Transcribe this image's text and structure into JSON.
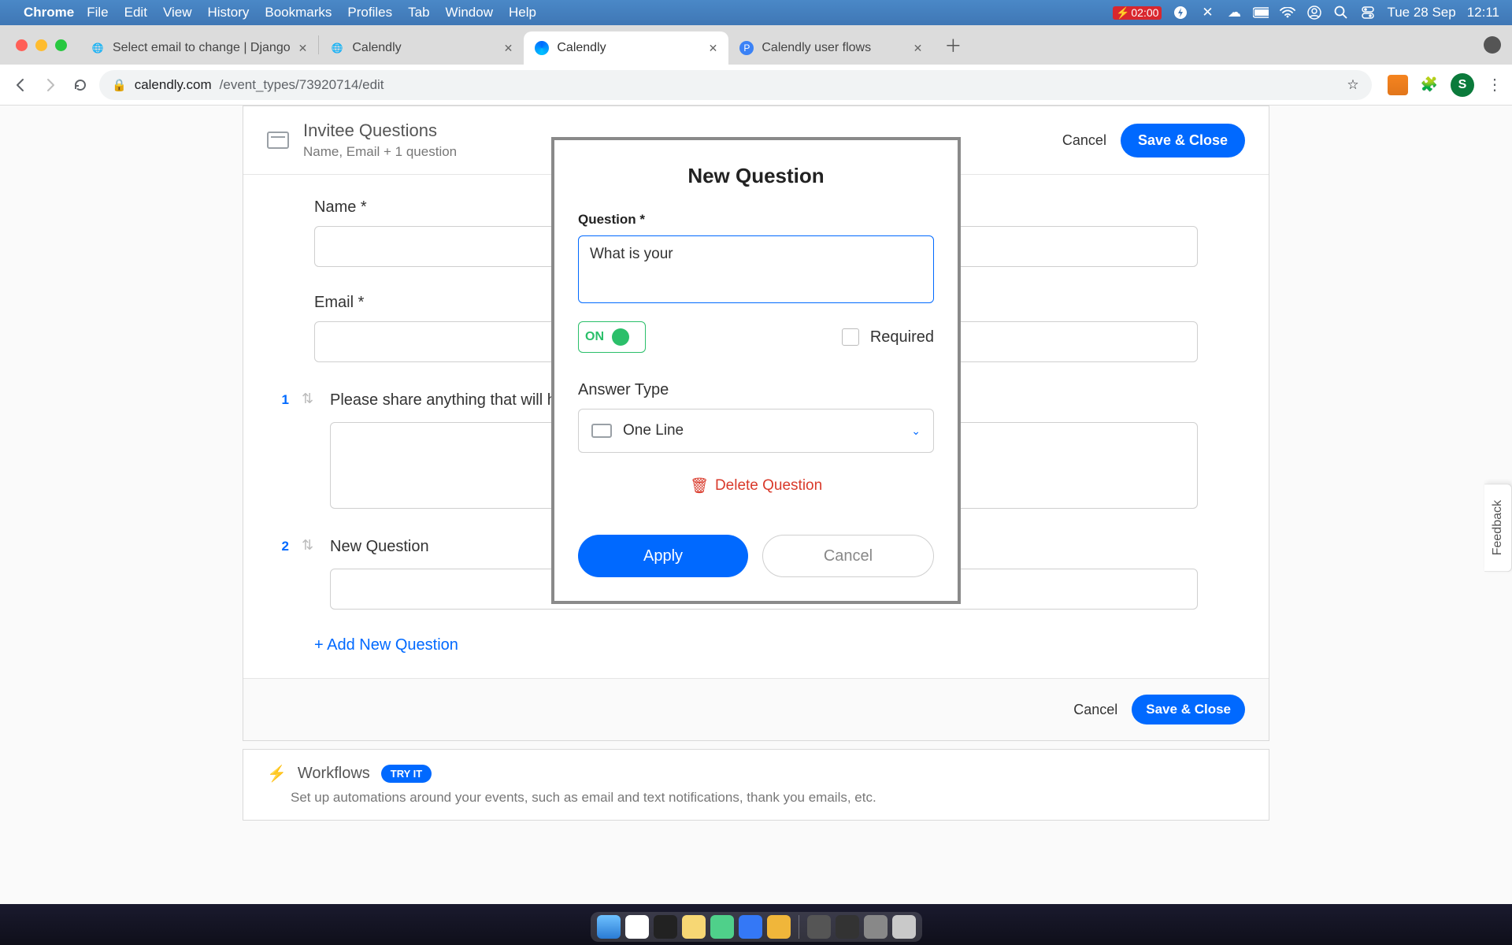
{
  "menubar": {
    "app": "Chrome",
    "items": [
      "File",
      "Edit",
      "View",
      "History",
      "Bookmarks",
      "Profiles",
      "Tab",
      "Window",
      "Help"
    ],
    "battery_time": "02:00",
    "date": "Tue 28 Sep",
    "clock": "12:11"
  },
  "browser": {
    "tabs": [
      {
        "title": "Select email to change | Django",
        "active": false
      },
      {
        "title": "Calendly",
        "active": false
      },
      {
        "title": "Calendly",
        "active": true
      },
      {
        "title": "Calendly user flows",
        "active": false
      }
    ],
    "url_host": "calendly.com",
    "url_path": "/event_types/73920714/edit",
    "avatar_initial": "S"
  },
  "page": {
    "section_title": "Invitee Questions",
    "section_subtitle": "Name, Email + 1 question",
    "cancel": "Cancel",
    "save_close": "Save & Close",
    "fields": {
      "name_label": "Name *",
      "email_label": "Email *"
    },
    "q1": {
      "num": "1",
      "text": "Please share anything that will help prepare for our meeting."
    },
    "q2": {
      "num": "2",
      "text": "New Question"
    },
    "add_new": "+ Add New Question",
    "footer_cancel": "Cancel",
    "footer_save": "Save & Close",
    "feedback": "Feedback"
  },
  "workflows": {
    "title": "Workflows",
    "badge": "TRY IT",
    "subtitle": "Set up automations around your events, such as email and text notifications, thank you emails, etc."
  },
  "modal": {
    "title": "New Question",
    "question_label": "Question *",
    "question_value": "What is your ",
    "toggle_label": "ON",
    "required_label": "Required",
    "answer_type_label": "Answer Type",
    "answer_type_value": "One Line",
    "delete": "Delete Question",
    "apply": "Apply",
    "cancel": "Cancel"
  }
}
